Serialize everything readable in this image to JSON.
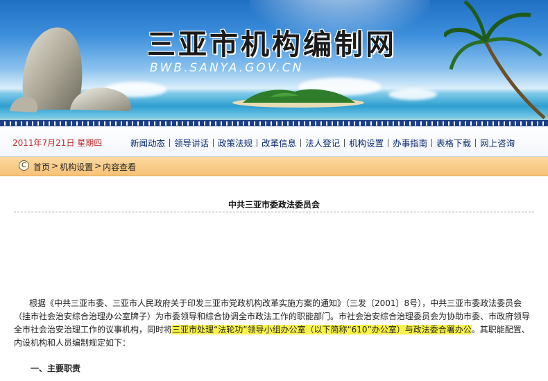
{
  "banner": {
    "title": "三亚市机构编制网",
    "url": "BWB.SANYA.GOV.CN"
  },
  "navbar": {
    "date": "2011年7月21日 星期四",
    "items": [
      "新闻动态",
      "领导讲话",
      "政策法规",
      "改革信息",
      "法人登记",
      "机构设置",
      "办事指南",
      "表格下载",
      "网上咨询"
    ]
  },
  "breadcrumb": {
    "icon": "circle-c-icon",
    "items": [
      "首页",
      "机构设置",
      "内容查看"
    ]
  },
  "article": {
    "title": "中共三亚市委政法委员会",
    "para_before": "根据《中共三亚市委、三亚市人民政府关于印发三亚市党政机构改革实施方案的通知》（三发〔2001〕8号），中共三亚市委政法委员会（挂市社会治安综合治理办公室牌子）为市委领导和综合协调全市政法工作的职能部门。市社会治安综合治理委员会为协助市委、市政府领导全市社会治安治理工作的议事机构，同时将",
    "para_highlight": "三亚市处理“法轮功”领导小组办公室（以下简称“610”办公室）与政法委合署办公",
    "para_after": "。其职能配置、内设机构和人员编制规定如下：",
    "section_heading": "一、主要职责"
  },
  "colors": {
    "date_red": "#c0262a",
    "nav_blue": "#0b2a73",
    "breadcrumb_orange": "#f7c277",
    "highlight_yellow": "#f9f24a"
  }
}
